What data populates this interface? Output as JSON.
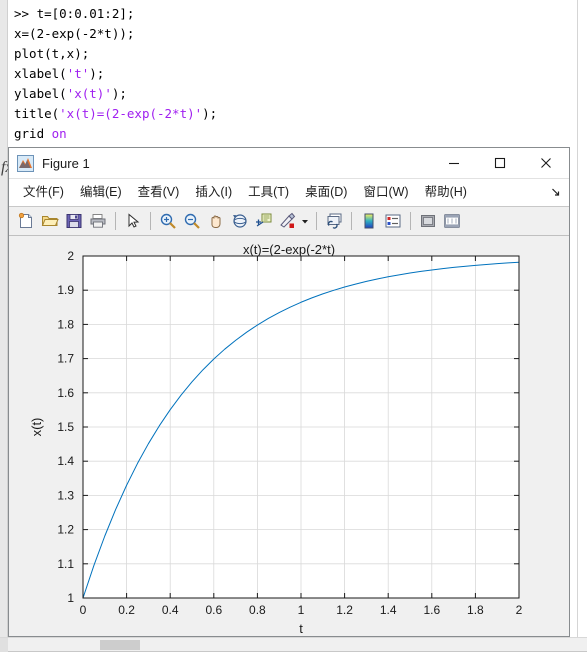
{
  "command_window": {
    "lines": [
      {
        "segments": [
          {
            "text": ">> ",
            "type": "prompt"
          },
          {
            "text": "t=[0:0.01:2];",
            "type": "plain"
          }
        ]
      },
      {
        "segments": [
          {
            "text": "x=(2-exp(-2*t));",
            "type": "plain"
          }
        ]
      },
      {
        "segments": [
          {
            "text": "plot(t,x);",
            "type": "plain"
          }
        ]
      },
      {
        "segments": [
          {
            "text": "xlabel(",
            "type": "plain"
          },
          {
            "text": "'t'",
            "type": "string"
          },
          {
            "text": ");",
            "type": "plain"
          }
        ]
      },
      {
        "segments": [
          {
            "text": "ylabel(",
            "type": "plain"
          },
          {
            "text": "'x(t)'",
            "type": "string"
          },
          {
            "text": ");",
            "type": "plain"
          }
        ]
      },
      {
        "segments": [
          {
            "text": "title(",
            "type": "plain"
          },
          {
            "text": "'x(t)=(2-exp(-2*t)'",
            "type": "string"
          },
          {
            "text": ");",
            "type": "plain"
          }
        ]
      },
      {
        "segments": [
          {
            "text": "grid ",
            "type": "plain"
          },
          {
            "text": "on",
            "type": "keyword"
          }
        ]
      }
    ],
    "fx_icon_label": "fx",
    "string_color": "#a020f0",
    "text_color": "#000000"
  },
  "figure_window": {
    "title": "Figure 1",
    "app_icon": "matlab-membrane-icon",
    "window_controls": [
      {
        "name": "minimize",
        "glyph": "minimize-icon"
      },
      {
        "name": "maximize",
        "glyph": "maximize-icon"
      },
      {
        "name": "close",
        "glyph": "close-icon"
      }
    ],
    "menu": [
      {
        "label": "文件(F)",
        "name": "file"
      },
      {
        "label": "编辑(E)",
        "name": "edit"
      },
      {
        "label": "查看(V)",
        "name": "view"
      },
      {
        "label": "插入(I)",
        "name": "insert"
      },
      {
        "label": "工具(T)",
        "name": "tools"
      },
      {
        "label": "桌面(D)",
        "name": "desktop"
      },
      {
        "label": "窗口(W)",
        "name": "window"
      },
      {
        "label": "帮助(H)",
        "name": "help"
      }
    ],
    "menu_overflow_icon": "overflow-arrow-icon",
    "toolbar": [
      {
        "name": "new-figure-icon",
        "group": 1
      },
      {
        "name": "open-file-icon",
        "group": 1
      },
      {
        "name": "save-figure-icon",
        "group": 1
      },
      {
        "name": "print-figure-icon",
        "group": 1
      },
      {
        "name": "pointer-select-icon",
        "group": 2
      },
      {
        "name": "zoom-in-icon",
        "group": 3
      },
      {
        "name": "zoom-out-icon",
        "group": 3
      },
      {
        "name": "pan-hand-icon",
        "group": 3
      },
      {
        "name": "rotate-3d-icon",
        "group": 3
      },
      {
        "name": "data-cursor-icon",
        "group": 3
      },
      {
        "name": "brush-data-icon",
        "group": 3
      },
      {
        "name": "brush-dropdown-caret-icon",
        "group": 3
      },
      {
        "name": "link-data-icon",
        "group": 4
      },
      {
        "name": "colorbar-icon",
        "group": 5
      },
      {
        "name": "legend-icon",
        "group": 5
      },
      {
        "name": "figure-palette-icon",
        "group": 6
      },
      {
        "name": "plot-browser-icon",
        "group": 6
      }
    ]
  },
  "chart_data": {
    "type": "line",
    "title": "x(t)=(2-exp(-2*t)",
    "xlabel": "t",
    "ylabel": "x(t)",
    "xlim": [
      0,
      2
    ],
    "ylim": [
      1,
      2
    ],
    "xticks": [
      "0",
      "0.2",
      "0.4",
      "0.6",
      "0.8",
      "1",
      "1.2",
      "1.4",
      "1.6",
      "1.8",
      "2"
    ],
    "xtick_values": [
      0,
      0.2,
      0.4,
      0.6,
      0.8,
      1,
      1.2,
      1.4,
      1.6,
      1.8,
      2
    ],
    "yticks": [
      "1",
      "1.1",
      "1.2",
      "1.3",
      "1.4",
      "1.5",
      "1.6",
      "1.7",
      "1.8",
      "1.9",
      "2"
    ],
    "ytick_values": [
      1,
      1.1,
      1.2,
      1.3,
      1.4,
      1.5,
      1.6,
      1.7,
      1.8,
      1.9,
      2
    ],
    "grid": true,
    "legend": null,
    "line_color": "#0072bd",
    "line_width": 1,
    "series": [
      {
        "name": "x(t) = 2 - exp(-2t)",
        "expression": "2-exp(-2*t)",
        "x": [
          0,
          0.05,
          0.1,
          0.15,
          0.2,
          0.25,
          0.3,
          0.35,
          0.4,
          0.45,
          0.5,
          0.55,
          0.6,
          0.65,
          0.7,
          0.75,
          0.8,
          0.85,
          0.9,
          0.95,
          1.0,
          1.05,
          1.1,
          1.15,
          1.2,
          1.25,
          1.3,
          1.35,
          1.4,
          1.45,
          1.5,
          1.55,
          1.6,
          1.65,
          1.7,
          1.75,
          1.8,
          1.85,
          1.9,
          1.95,
          2.0
        ],
        "values": [
          1.0,
          1.0952,
          1.1813,
          1.2592,
          1.3297,
          1.3935,
          1.4512,
          1.5034,
          1.5507,
          1.5934,
          1.6321,
          1.6671,
          1.6988,
          1.7275,
          1.7534,
          1.7769,
          1.7981,
          1.8173,
          1.8347,
          1.8504,
          1.8647,
          1.8775,
          1.8892,
          1.8997,
          1.9093,
          1.9179,
          1.9257,
          1.9328,
          1.9392,
          1.9449,
          1.9502,
          1.9549,
          1.9592,
          1.9631,
          1.9666,
          1.9698,
          1.9727,
          1.9753,
          1.9776,
          1.9798,
          1.9817
        ]
      }
    ]
  }
}
